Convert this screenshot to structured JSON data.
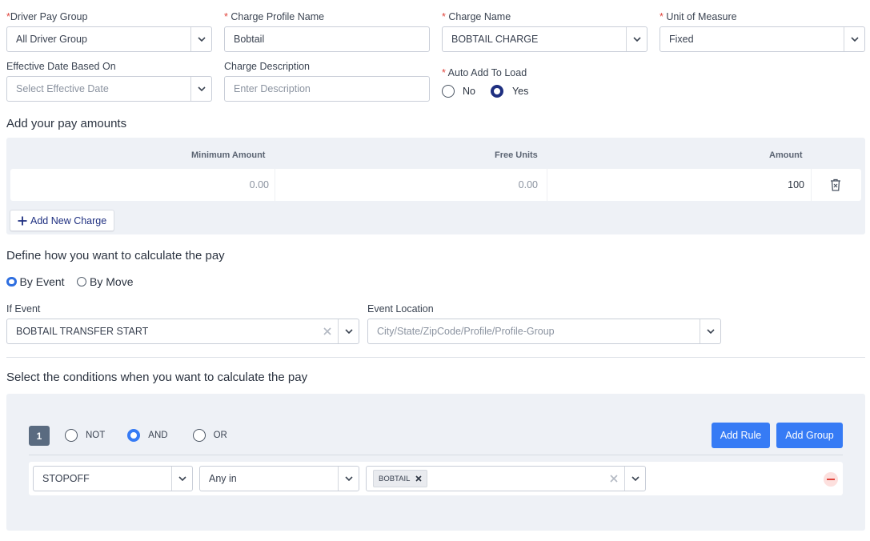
{
  "fields": {
    "driver_pay_group": {
      "label": "Driver Pay Group",
      "value": "All Driver Group"
    },
    "charge_profile_name": {
      "label": "Charge Profile Name",
      "value": "Bobtail"
    },
    "charge_name": {
      "label": "Charge Name",
      "value": "BOBTAIL CHARGE"
    },
    "unit_of_measure": {
      "label": "Unit of Measure",
      "value": "Fixed"
    },
    "effective_date": {
      "label": "Effective Date Based On",
      "placeholder": "Select Effective Date"
    },
    "charge_description": {
      "label": "Charge Description",
      "placeholder": "Enter Description"
    },
    "auto_add": {
      "label": "Auto Add To Load",
      "options": [
        "No",
        "Yes"
      ],
      "selected": "Yes"
    }
  },
  "required_mark": "*",
  "pay_amounts": {
    "title": "Add your pay amounts",
    "columns": [
      "Minimum Amount",
      "Free Units",
      "Amount"
    ],
    "rows": [
      {
        "minimum": "0.00",
        "free_units": "0.00",
        "amount": "100"
      }
    ],
    "add_button": "Add New Charge"
  },
  "calculate": {
    "title": "Define how you want to calculate the pay",
    "options": [
      "By Event",
      "By Move"
    ],
    "selected": "By Event",
    "if_event": {
      "label": "If Event",
      "value": "BOBTAIL TRANSFER START"
    },
    "event_location": {
      "label": "Event Location",
      "placeholder": "City/State/ZipCode/Profile/Profile-Group"
    }
  },
  "conditions": {
    "title": "Select the conditions when you want to calculate the pay",
    "group_index": "1",
    "operators": [
      "NOT",
      "AND",
      "OR"
    ],
    "selected_operator": "AND",
    "add_rule": "Add Rule",
    "add_group": "Add Group",
    "rule": {
      "field": "STOPOFF",
      "operator": "Any in",
      "tags": [
        "BOBTAIL"
      ]
    }
  },
  "colors": {
    "primary": "#367bf5",
    "navy": "#1e2f80",
    "panel": "#eef1f6",
    "danger": "#e0453d"
  }
}
